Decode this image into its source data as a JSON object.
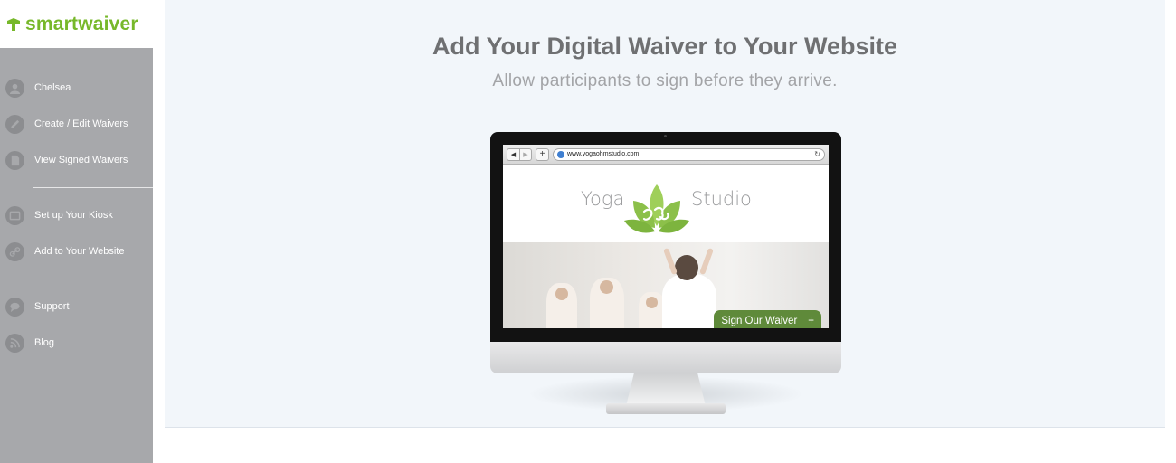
{
  "brand": {
    "name": "smartwaiver",
    "color": "#77b82a"
  },
  "sidebar": {
    "items": [
      {
        "label": "Chelsea",
        "icon": "user-icon"
      },
      {
        "label": "Create / Edit Waivers",
        "icon": "pencil-icon"
      },
      {
        "label": "View Signed Waivers",
        "icon": "document-icon"
      },
      {
        "label": "Set up Your Kiosk",
        "icon": "kiosk-icon"
      },
      {
        "label": "Add to Your Website",
        "icon": "link-icon"
      },
      {
        "label": "Support",
        "icon": "chat-bubble-icon"
      },
      {
        "label": "Blog",
        "icon": "rss-icon"
      }
    ]
  },
  "main": {
    "title": "Add Your Digital Waiver to Your Website",
    "subtitle": "Allow participants to sign before they arrive."
  },
  "preview": {
    "url": "www.yogaohmstudio.com",
    "site_word_left": "Yoga",
    "site_word_right": "Studio",
    "cta_label": "Sign Our Waiver",
    "cta_plus": "+",
    "cta_color": "#5f8a3a"
  }
}
